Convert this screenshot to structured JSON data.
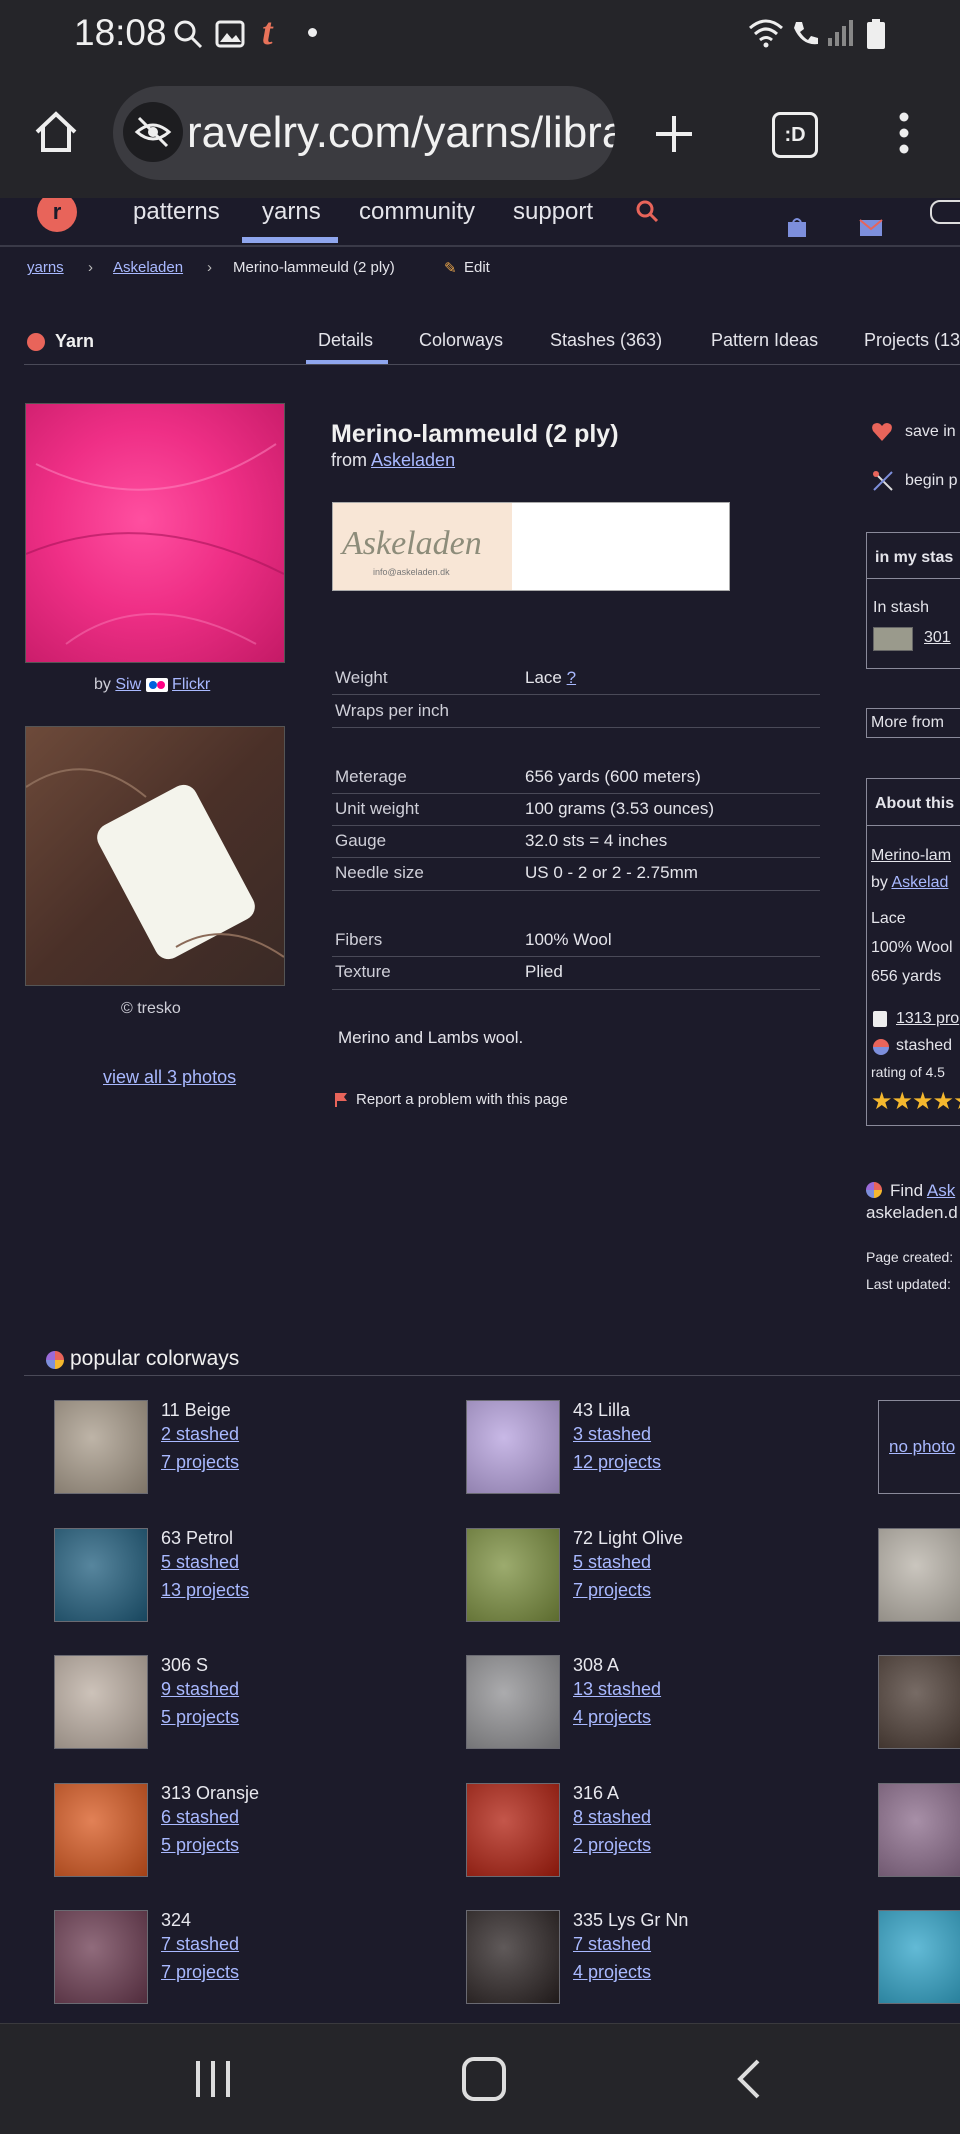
{
  "status": {
    "time": "18:08"
  },
  "browser": {
    "url": "ravelry.com/yarns/libra",
    "tabs_label": ":D"
  },
  "nav": {
    "patterns": "patterns",
    "yarns": "yarns",
    "community": "community",
    "support": "support"
  },
  "breadcrumb": {
    "yarns": "yarns",
    "brand": "Askeladen",
    "current": "Merino-lammeuld (2 ply)",
    "edit": "Edit"
  },
  "tabs": {
    "section": "Yarn",
    "details": "Details",
    "colorways": "Colorways",
    "stashes": "Stashes (363)",
    "pattern_ideas": "Pattern Ideas",
    "projects": "Projects (13"
  },
  "photos": {
    "credit1_by": "by",
    "credit1_user": "Siw",
    "credit1_site": "Flickr",
    "credit2": "© tresko",
    "view_all": "view all 3 photos"
  },
  "yarn": {
    "name": "Merino-lammeuld (2 ply)",
    "from_label": "from",
    "brand": "Askeladen",
    "logo_text": "Askeladen",
    "logo_email": "info@askeladen.dk",
    "specs": {
      "weight_label": "Weight",
      "weight_value": "Lace",
      "weight_help": "?",
      "wpi_label": "Wraps per inch",
      "meterage_label": "Meterage",
      "meterage_value": "656 yards (600 meters)",
      "unit_weight_label": "Unit weight",
      "unit_weight_value": "100 grams (3.53 ounces)",
      "gauge_label": "Gauge",
      "gauge_value": "32.0 sts = 4 inches",
      "needle_label": "Needle size",
      "needle_value": "US 0 - 2 or 2 - 2.75mm",
      "fibers_label": "Fibers",
      "fibers_value": "100% Wool",
      "texture_label": "Texture",
      "texture_value": "Plied"
    },
    "description": "Merino and Lambs wool.",
    "report": "Report a problem with this page"
  },
  "sidebar": {
    "save": "save in",
    "begin": "begin p",
    "in_my_stash": "in my stas",
    "in_stash": "In stash",
    "stash_count": "301",
    "more_from": "More from",
    "about": "About this",
    "about_name": "Merino-lam",
    "about_by": "by",
    "about_brand": "Askelad",
    "about_weight": "Lace",
    "about_fiber": "100% Wool",
    "about_yards": "656 yards",
    "about_projects": "1313 pro",
    "about_stashed": "stashed",
    "about_rating": "rating of 4.5",
    "find_label": "Find",
    "find_brand": "Ask",
    "find_site": "askeladen.d",
    "page_created": "Page created:",
    "last_updated": "Last updated:"
  },
  "colorways": {
    "heading": "popular colorways",
    "no_photo": "no photo",
    "items": [
      {
        "name": "11 Beige",
        "stashed": "2 stashed",
        "projects": "7 projects",
        "color": "#a89b8a"
      },
      {
        "name": "43 Lilla",
        "stashed": "3 stashed",
        "projects": "12 projects",
        "color": "#b6a1de"
      },
      {
        "name": "63 Petrol",
        "stashed": "5 stashed",
        "projects": "13 projects",
        "color": "#1f5d7d"
      },
      {
        "name": "72 Light Olive",
        "stashed": "5 stashed",
        "projects": "7 projects",
        "color": "#7b8f3e"
      },
      {
        "name": "306 S",
        "stashed": "9 stashed",
        "projects": "5 projects",
        "color": "#bcaea2"
      },
      {
        "name": "308 A",
        "stashed": "13 stashed",
        "projects": "4 projects",
        "color": "#8f8f92"
      },
      {
        "name": "313 Oransje",
        "stashed": "6 stashed",
        "projects": "5 projects",
        "color": "#d8571e"
      },
      {
        "name": "316 A",
        "stashed": "8 stashed",
        "projects": "2 projects",
        "color": "#b01e0e"
      },
      {
        "name": "324",
        "stashed": "7 stashed",
        "projects": "7 projects",
        "color": "#6b3a50"
      },
      {
        "name": "335 Lys Gr Nn",
        "stashed": "7 stashed",
        "projects": "4 projects",
        "color": "#2a2222"
      }
    ],
    "third_col_colors": [
      "#b8b2a8",
      "#4a3a32",
      "#8a6a8a",
      "#2ea3c8"
    ]
  }
}
